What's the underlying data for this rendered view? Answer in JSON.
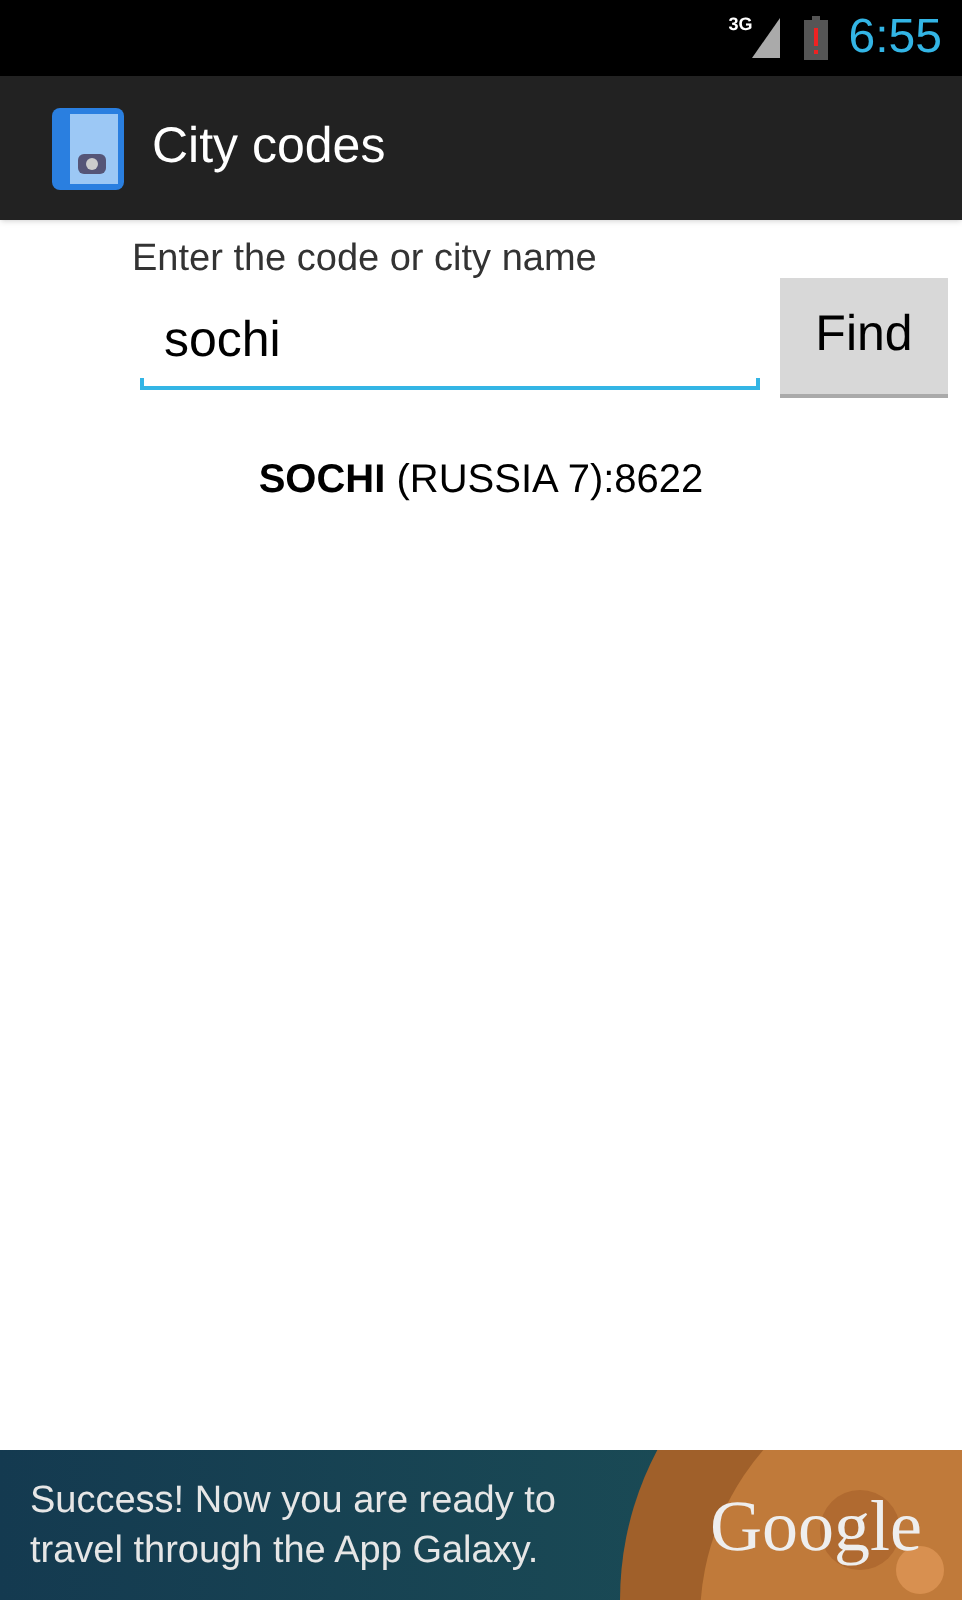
{
  "status_bar": {
    "network": "3G",
    "time": "6:55"
  },
  "action_bar": {
    "title": "City codes"
  },
  "search": {
    "label": "Enter the code or city name",
    "value": "sochi",
    "button": "Find"
  },
  "result": "**SOCHI** (RUSSIA 7):8622",
  "ad": {
    "text": "Success! Now you are ready to travel through the App Galaxy.",
    "brand": "Google"
  }
}
